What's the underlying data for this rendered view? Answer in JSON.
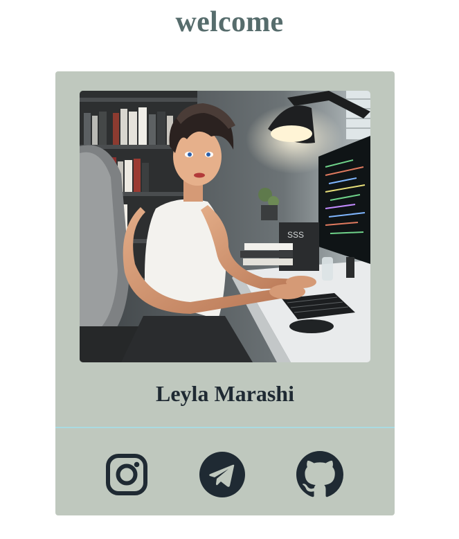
{
  "page": {
    "title": "welcome"
  },
  "profile": {
    "name": "Leyla Marashi",
    "photo_icon": "developer-portrait-illustration"
  },
  "social_links": [
    {
      "name": "instagram",
      "icon": "instagram-icon"
    },
    {
      "name": "telegram",
      "icon": "telegram-icon"
    },
    {
      "name": "github",
      "icon": "github-icon"
    }
  ],
  "colors": {
    "title": "#566c6c",
    "card_background": "#bfc8be",
    "divider": "#a9dbe2",
    "text_dark": "#1f2a33"
  }
}
